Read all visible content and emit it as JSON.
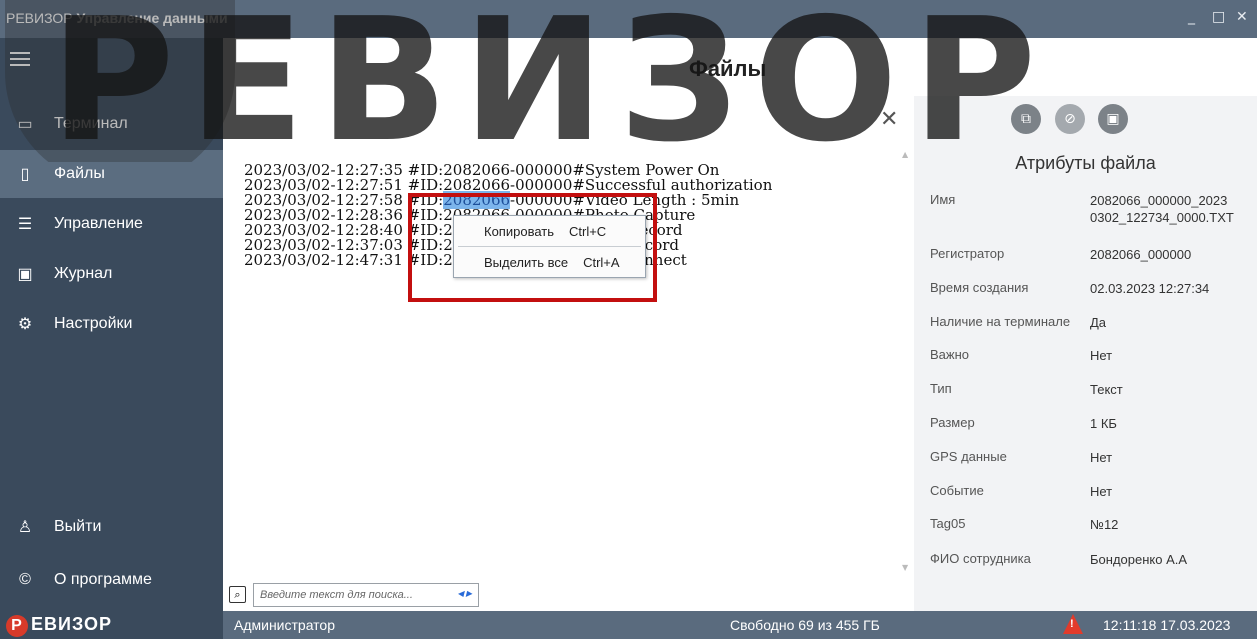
{
  "titlebar": {
    "app_prefix": "РЕВИЗОР",
    "app_title": "Управление данными",
    "minimize": "_",
    "maximize": "□",
    "close": "✕"
  },
  "sidebar": {
    "items": [
      {
        "label": "Терминал",
        "icon": "terminal-icon",
        "glyph": "▭"
      },
      {
        "label": "Файлы",
        "icon": "files-icon",
        "glyph": "▯",
        "active": true
      },
      {
        "label": "Управление",
        "icon": "sliders-icon",
        "glyph": "☰"
      },
      {
        "label": "Журнал",
        "icon": "journal-icon",
        "glyph": "▣"
      },
      {
        "label": "Настройки",
        "icon": "gear-icon",
        "glyph": "⚙"
      }
    ],
    "bottom": [
      {
        "label": "Выйти",
        "icon": "user-icon",
        "glyph": "♙"
      },
      {
        "label": "О программе",
        "icon": "copyright-icon",
        "glyph": "©"
      }
    ]
  },
  "header": {
    "title": "Файлы"
  },
  "log": {
    "lines": [
      "2023/03/02-12:27:35 #ID:2082066-000000#System Power On",
      "2023/03/02-12:27:51 #ID:2082066-000000#Successful authorization",
      "2023/03/02-12:27:58 #ID:2082066-000000#Video Length : 5min",
      "2023/03/02-12:28:36 #ID:2082066-000000#Photo Capture",
      "2023/03/02-12:28:40 #ID:2082066-000000#Start Record",
      "2023/03/02-12:37:03 #ID:2082066-000000#Stop Record",
      "2023/03/02-12:47:31 #ID:2082066-000000#USB Connect"
    ],
    "selection": "2082066"
  },
  "context_menu": {
    "items": [
      {
        "label": "Копировать",
        "shortcut": "Ctrl+C"
      },
      {
        "label": "Выделить все",
        "shortcut": "Ctrl+A"
      }
    ]
  },
  "search": {
    "placeholder": "Введите текст для поиска..."
  },
  "attributes": {
    "title": "Атрибуты файла",
    "rows": [
      {
        "key": "Имя",
        "value": "2082066_000000_2023\n0302_122734_0000.TXT"
      },
      {
        "key": "Регистратор",
        "value": "2082066_000000"
      },
      {
        "key": "Время создания",
        "value": "02.03.2023 12:27:34"
      },
      {
        "key": "Наличие на терминале",
        "value": "Да"
      },
      {
        "key": "Важно",
        "value": "Нет"
      },
      {
        "key": "Тип",
        "value": "Текст"
      },
      {
        "key": "Размер",
        "value": "1 КБ"
      },
      {
        "key": "GPS данные",
        "value": "Нет"
      },
      {
        "key": "Событие",
        "value": "Нет"
      },
      {
        "key": "Tag05",
        "value": "№12"
      },
      {
        "key": "ФИО сотрудника",
        "value": "Бондоренко А.А"
      }
    ]
  },
  "statusbar": {
    "logo_letter": "Р",
    "logo_text": "ЕВИЗОР",
    "user": "Администратор",
    "free_space": "Свободно 69 из 455 ГБ",
    "clock": "12:11:18 17.03.2023"
  },
  "watermark": "РЕВИЗОР",
  "colors": {
    "sidebar": "#3a4a5c",
    "titlebar": "#5a6b7e",
    "accent": "#c30f0f",
    "selection": "#7cb5ec"
  }
}
